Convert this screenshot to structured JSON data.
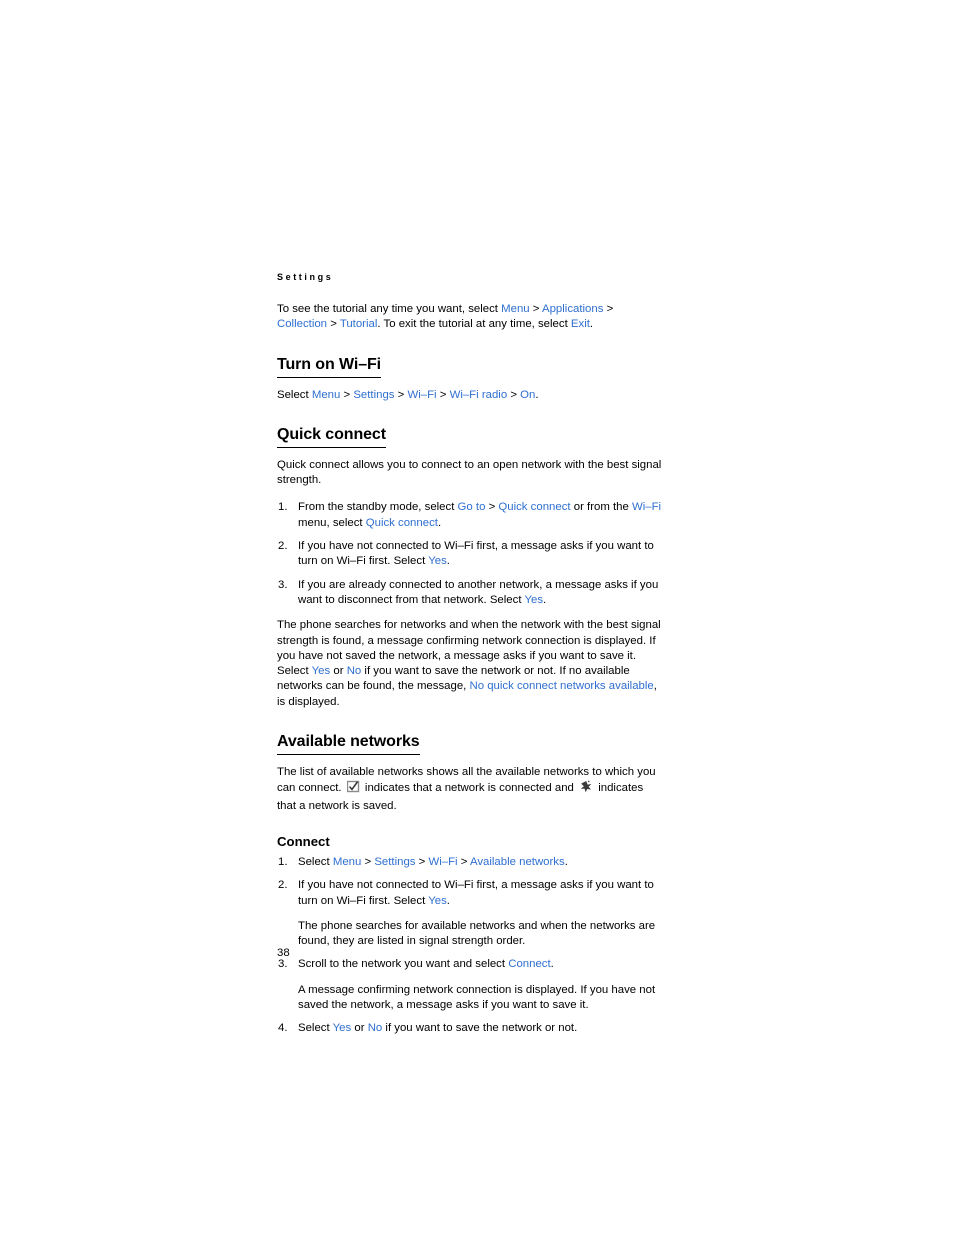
{
  "running_head": "Settings",
  "page_number": "38",
  "intro": {
    "t1": "To see the tutorial any time you want, select ",
    "l1": "Menu",
    "s1": " > ",
    "l2": "Applications",
    "s2": " > ",
    "l3": "Collection",
    "s3": " > ",
    "l4": "Tutorial",
    "t2": ". To exit the tutorial at any time, select ",
    "l5": "Exit",
    "t3": "."
  },
  "section_turn_on": {
    "heading": "Turn on Wi–Fi",
    "t1": "Select ",
    "l1": "Menu",
    "s1": " > ",
    "l2": "Settings",
    "s2": " > ",
    "l3": "Wi–Fi",
    "s3": " > ",
    "l4": "Wi–Fi radio",
    "s4": " > ",
    "l5": "On",
    "t2": "."
  },
  "section_quick_connect": {
    "heading": "Quick connect",
    "intro": "Quick connect allows you to connect to an open network with the best signal strength.",
    "step1": {
      "t1": "From the standby mode, select ",
      "l1": "Go to",
      "s1": " > ",
      "l2": "Quick connect",
      "t2": " or from the ",
      "l3": "Wi–Fi",
      "t3": " menu, select ",
      "l4": "Quick connect",
      "t4": "."
    },
    "step2": {
      "t1": "If you have not connected to Wi–Fi first, a message asks if you want to turn on Wi–Fi first. Select ",
      "l1": "Yes",
      "t2": "."
    },
    "step3": {
      "t1": "If you are already connected to another network, a message asks if you want to disconnect from that network. Select ",
      "l1": "Yes",
      "t2": "."
    },
    "outro": {
      "t1": "The phone searches for networks and when the network with the best signal strength is found, a message confirming network connection is displayed. If you have not saved the network, a message asks if you want to save it. Select ",
      "l1": "Yes",
      "t2": " or ",
      "l2": "No",
      "t3": " if you want to save the network or not. If no available networks can be found, the message, ",
      "l3": "No quick connect networks available",
      "t4": ", is displayed."
    }
  },
  "section_available_networks": {
    "heading": "Available networks",
    "desc": {
      "t1": "The list of available networks shows all the available networks to which you can connect. ",
      "icon1": "checked-box-icon",
      "t2": " indicates that a network is connected and ",
      "icon2": "saved-network-star-icon",
      "t3": " indicates that a network is saved."
    },
    "connect": {
      "heading": "Connect",
      "step1": {
        "t1": "Select ",
        "l1": "Menu",
        "s1": " > ",
        "l2": "Settings",
        "s2": " > ",
        "l3": "Wi–Fi",
        "s3": " > ",
        "l4": "Available networks",
        "t2": "."
      },
      "step2": {
        "t1": "If you have not connected to Wi–Fi first, a message asks if you want to turn on Wi–Fi first. Select ",
        "l1": "Yes",
        "t2": ".",
        "sub": "The phone searches for available networks and when the networks are found, they are listed in signal strength order."
      },
      "step3": {
        "t1": "Scroll to the network you want and select ",
        "l1": "Connect",
        "t2": ".",
        "sub": "A message confirming network connection is displayed. If you have not saved the network, a message asks if you want to save it."
      },
      "step4": {
        "t1": "Select ",
        "l1": "Yes",
        "t2": " or ",
        "l2": "No",
        "t3": " if you want to save the network or not."
      }
    }
  },
  "colors": {
    "link": "#2f6fd0",
    "text": "#000000",
    "background": "#ffffff"
  }
}
